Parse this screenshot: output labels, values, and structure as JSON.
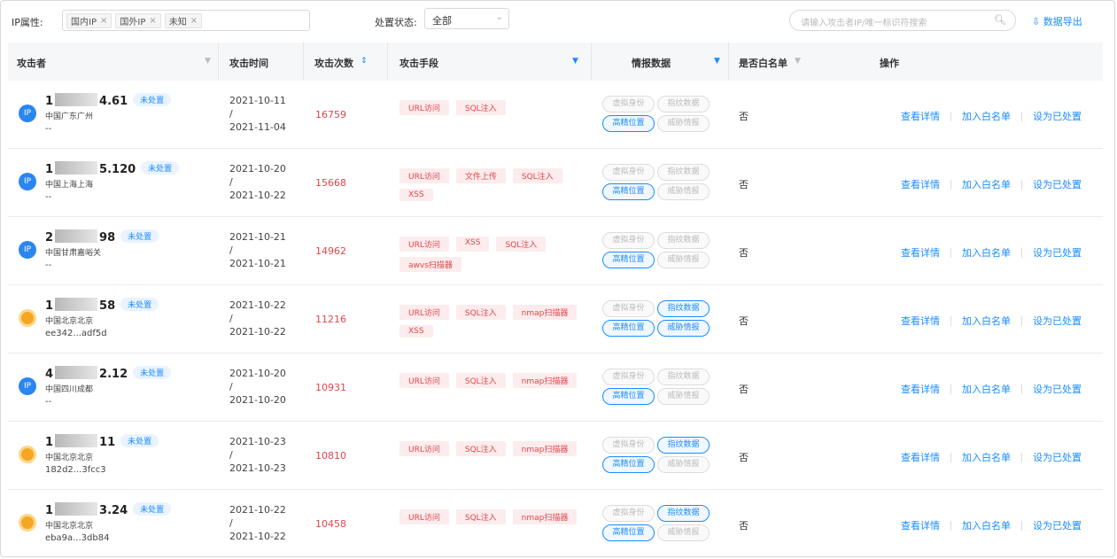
{
  "filters": {
    "ip_attr_label": "IP属性:",
    "ip_chips": [
      "国内IP",
      "国外IP",
      "未知"
    ],
    "status_label": "处置状态:",
    "status_value": "全部",
    "search_placeholder": "请输入攻击者IP/唯一标识符搜索",
    "export_label": "数据导出"
  },
  "columns": {
    "attacker": "攻击者",
    "time": "攻击时间",
    "count": "攻击次数",
    "method": "攻击手段",
    "intel": "情报数据",
    "whitelist": "是否白名单",
    "action": "操作"
  },
  "intel_labels": [
    "虚拟身份",
    "指纹数据",
    "高精位置",
    "威胁情报"
  ],
  "action_labels": {
    "detail": "查看详情",
    "whitelist": "加入白名单",
    "handled": "设为已处置"
  },
  "rows": [
    {
      "avatar": "IP",
      "ip_pre": "1",
      "ip_suf": "4.61",
      "status": "未处置",
      "location": "中国广东广州",
      "uid": "--",
      "time_start": "2021-10-11",
      "time_sep": "/",
      "time_end": "2021-11-04",
      "count": "16759",
      "methods": [
        "URL访问",
        "SQL注入"
      ],
      "intel_on": [
        false,
        false,
        true,
        false
      ],
      "whitelist": "否"
    },
    {
      "avatar": "IP",
      "ip_pre": "1",
      "ip_suf": "5.120",
      "status": "未处置",
      "location": "中国上海上海",
      "uid": "--",
      "time_start": "2021-10-20",
      "time_sep": "/",
      "time_end": "2021-10-22",
      "count": "15668",
      "methods": [
        "URL访问",
        "文件上传",
        "SQL注入",
        "XSS"
      ],
      "intel_on": [
        false,
        false,
        true,
        false
      ],
      "whitelist": "否"
    },
    {
      "avatar": "IP",
      "ip_pre": "2",
      "ip_suf": "98",
      "status": "未处置",
      "location": "中国甘肃嘉峪关",
      "uid": "--",
      "time_start": "2021-10-21",
      "time_sep": "/",
      "time_end": "2021-10-21",
      "count": "14962",
      "methods": [
        "URL访问",
        "XSS",
        "SQL注入",
        "awvs扫描器"
      ],
      "intel_on": [
        false,
        false,
        true,
        false
      ],
      "whitelist": "否"
    },
    {
      "avatar": "sun",
      "ip_pre": "1",
      "ip_suf": "58",
      "status": "未处置",
      "location": "中国北京北京",
      "uid": "ee342...adf5d",
      "time_start": "2021-10-22",
      "time_sep": "/",
      "time_end": "2021-10-22",
      "count": "11216",
      "methods": [
        "URL访问",
        "SQL注入",
        "nmap扫描器",
        "XSS"
      ],
      "intel_on": [
        false,
        true,
        true,
        true
      ],
      "whitelist": "否"
    },
    {
      "avatar": "IP",
      "ip_pre": "4",
      "ip_suf": "2.12",
      "status": "未处置",
      "location": "中国四川成都",
      "uid": "--",
      "time_start": "2021-10-20",
      "time_sep": "/",
      "time_end": "2021-10-20",
      "count": "10931",
      "methods": [
        "URL访问",
        "SQL注入",
        "nmap扫描器"
      ],
      "intel_on": [
        false,
        false,
        true,
        false
      ],
      "whitelist": "否"
    },
    {
      "avatar": "sun",
      "ip_pre": "1",
      "ip_suf": "11",
      "status": "未处置",
      "location": "中国北京北京",
      "uid": "182d2...3fcc3",
      "time_start": "2021-10-23",
      "time_sep": "/",
      "time_end": "2021-10-23",
      "count": "10810",
      "methods": [
        "URL访问",
        "SQL注入",
        "nmap扫描器"
      ],
      "intel_on": [
        false,
        true,
        true,
        false
      ],
      "whitelist": "否"
    },
    {
      "avatar": "sun",
      "ip_pre": "1",
      "ip_suf": "3.24",
      "status": "未处置",
      "location": "中国北京北京",
      "uid": "eba9a...3db84",
      "time_start": "2021-10-22",
      "time_sep": "/",
      "time_end": "2021-10-22",
      "count": "10458",
      "methods": [
        "URL访问",
        "SQL注入",
        "nmap扫描器"
      ],
      "intel_on": [
        false,
        true,
        true,
        false
      ],
      "whitelist": "否"
    }
  ]
}
